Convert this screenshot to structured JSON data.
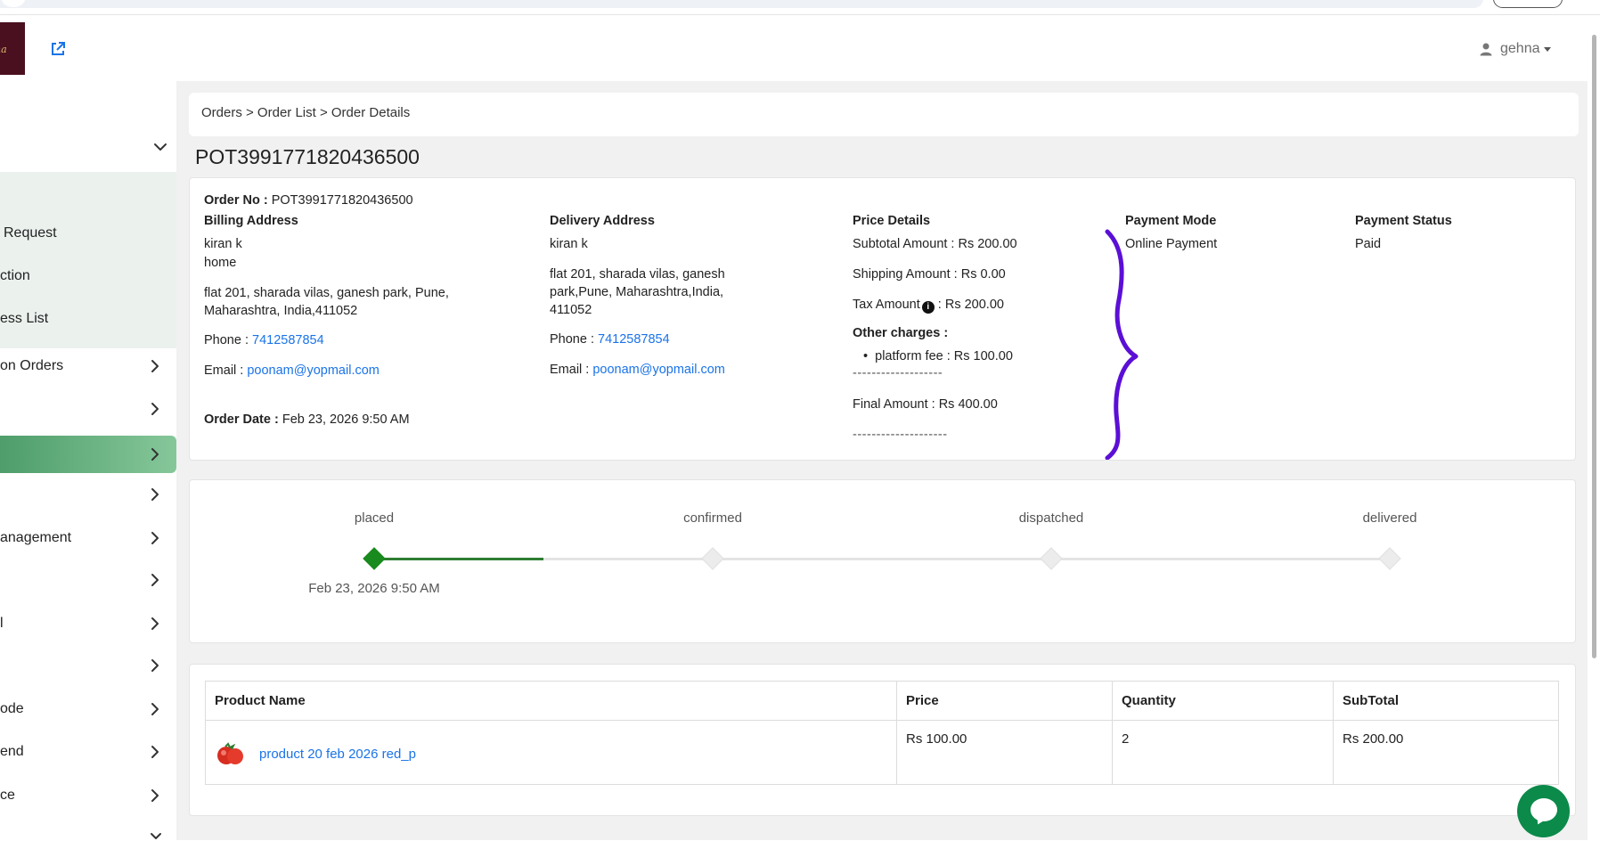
{
  "header": {
    "user_name": "gehna",
    "logo_text": "na"
  },
  "sidebar": {
    "items": [
      {
        "label": "Request"
      },
      {
        "label": "ction"
      },
      {
        "label": "ess List"
      },
      {
        "label": "on Orders"
      },
      {
        "label": ""
      },
      {
        "label": ""
      },
      {
        "label": ""
      },
      {
        "label": "anagement"
      },
      {
        "label": ""
      },
      {
        "label": "l"
      },
      {
        "label": ""
      },
      {
        "label": "ode"
      },
      {
        "label": "end"
      },
      {
        "label": "ce"
      }
    ]
  },
  "breadcrumb": {
    "text": "Orders > Order List > Order Details"
  },
  "order": {
    "title": "POT3991771820436500",
    "order_no_label": "Order No :",
    "order_no": "POT3991771820436500",
    "order_date_label": "Order Date :",
    "order_date": "Feb 23, 2026 9:50 AM"
  },
  "billing": {
    "heading": "Billing Address",
    "name": "kiran k",
    "type": "home",
    "address_line1": "flat 201, sharada vilas, ganesh park, Pune,",
    "address_line2": "Maharashtra, India,411052",
    "phone_label": "Phone :",
    "phone": "7412587854",
    "email_label": "Email :",
    "email": "poonam@yopmail.com"
  },
  "delivery": {
    "heading": "Delivery Address",
    "name": "kiran k",
    "address_line1": "flat 201, sharada vilas, ganesh",
    "address_line2": "park,Pune, Maharashtra,India,",
    "address_line3": "411052",
    "phone_label": "Phone :",
    "phone": "7412587854",
    "email_label": "Email :",
    "email": "poonam@yopmail.com"
  },
  "price": {
    "heading": "Price Details",
    "subtotal": "Subtotal Amount : Rs 200.00",
    "shipping": "Shipping Amount : Rs 0.00",
    "tax_label": "Tax Amount",
    "tax_value": ": Rs  200.00",
    "other_label": "Other charges :",
    "platform_fee": "platform fee :  Rs  100.00",
    "divider1": "-------------------",
    "final": "Final Amount : Rs  400.00",
    "divider2": "--------------------",
    "annotation_color": "#5b0fd6"
  },
  "payment": {
    "mode_heading": "Payment Mode",
    "mode": "Online Payment",
    "status_heading": "Payment Status",
    "status": "Paid"
  },
  "timeline": {
    "steps": [
      {
        "label": "placed",
        "done": true
      },
      {
        "label": "confirmed",
        "done": false
      },
      {
        "label": "dispatched",
        "done": false
      },
      {
        "label": "delivered",
        "done": false
      }
    ],
    "placed_date": "Feb 23, 2026 9:50 AM",
    "done_color": "#198a1d"
  },
  "products": {
    "columns": [
      "Product Name",
      "Price",
      "Quantity",
      "SubTotal"
    ],
    "rows": [
      {
        "name": "product 20 feb 2026 red_p",
        "price": "Rs 100.00",
        "quantity": "2",
        "subtotal": "Rs 200.00"
      }
    ]
  },
  "colors": {
    "accent": "#1a73e8",
    "sidebar_active": "#5fae7b",
    "chat": "#0b8a4a"
  }
}
